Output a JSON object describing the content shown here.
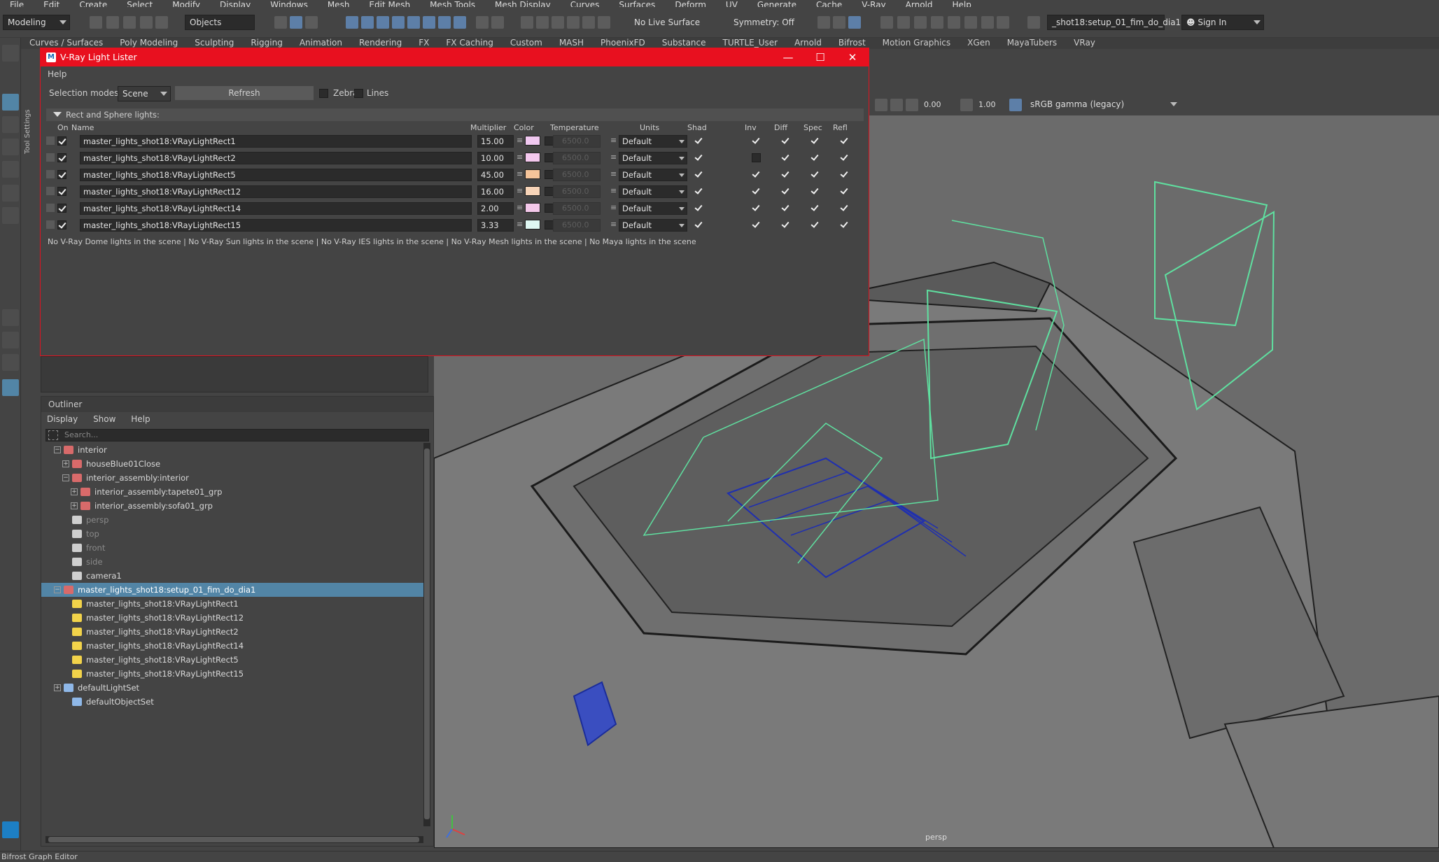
{
  "menubar": [
    "File",
    "Edit",
    "Create",
    "Select",
    "Modify",
    "Display",
    "Windows",
    "Mesh",
    "Edit Mesh",
    "Mesh Tools",
    "Mesh Display",
    "Curves",
    "Surfaces",
    "Deform",
    "UV",
    "Generate",
    "Cache",
    "V-Ray",
    "Arnold",
    "Help"
  ],
  "statusline": {
    "mode": "Modeling",
    "objects": "Objects",
    "live_surface": "No Live Surface",
    "symmetry": "Symmetry: Off",
    "scene_name": "_shot18:setup_01_fim_do_dia1",
    "sign_in": "Sign In"
  },
  "shelf_tabs": [
    "Curves / Surfaces",
    "Poly Modeling",
    "Sculpting",
    "Rigging",
    "Animation",
    "Rendering",
    "FX",
    "FX Caching",
    "Custom",
    "MASH",
    "PhoenixFD",
    "Substance",
    "TURTLE_User",
    "Arnold",
    "Bifrost",
    "Motion Graphics",
    "XGen",
    "MayaTubers",
    "VRay"
  ],
  "toolbox_label": "Tool Settings",
  "viewport": {
    "value_a": "0.00",
    "value_b": "1.00",
    "color_space": "sRGB gamma (legacy)",
    "camera_label": "persp"
  },
  "lister": {
    "title": "V-Ray Light Lister",
    "menu": "Help",
    "selection_label": "Selection modes:",
    "selection_value": "Scene",
    "refresh": "Refresh",
    "zebra": "Zebra",
    "lines": "Lines",
    "section": "Rect and Sphere lights:",
    "columns": {
      "on": "On",
      "name": "Name",
      "multiplier": "Multiplier",
      "color": "Color",
      "temperature": "Temperature",
      "units": "Units",
      "shad": "Shad",
      "inv": "Inv",
      "diff": "Diff",
      "spec": "Spec",
      "refl": "Refl"
    },
    "lights": [
      {
        "name": "master_lights_shot18:VRayLightRect1",
        "multiplier": "15.00",
        "color": "#f0c8f0",
        "temperature": "6500.0",
        "units": "Default",
        "inv": true
      },
      {
        "name": "master_lights_shot18:VRayLightRect2",
        "multiplier": "10.00",
        "color": "#f4c8ee",
        "temperature": "6500.0",
        "units": "Default",
        "inv": false
      },
      {
        "name": "master_lights_shot18:VRayLightRect5",
        "multiplier": "45.00",
        "color": "#f5c49a",
        "temperature": "6500.0",
        "units": "Default",
        "inv": true
      },
      {
        "name": "master_lights_shot18:VRayLightRect12",
        "multiplier": "16.00",
        "color": "#f7d4b8",
        "temperature": "6500.0",
        "units": "Default",
        "inv": true
      },
      {
        "name": "master_lights_shot18:VRayLightRect14",
        "multiplier": "2.00",
        "color": "#f4c8ea",
        "temperature": "6500.0",
        "units": "Default",
        "inv": true
      },
      {
        "name": "master_lights_shot18:VRayLightRect15",
        "multiplier": "3.33",
        "color": "#dff7f2",
        "temperature": "6500.0",
        "units": "Default",
        "inv": true
      }
    ],
    "footer": "No V-Ray Dome lights in the scene | No V-Ray Sun lights in the scene | No V-Ray IES lights in the scene | No V-Ray Mesh lights in the scene | No Maya lights in the scene"
  },
  "outliner": {
    "title": "Outliner",
    "menu": [
      "Display",
      "Show",
      "Help"
    ],
    "search_placeholder": "Search...",
    "items": [
      {
        "label": "interior",
        "type": "group",
        "expander": "−",
        "dim": false,
        "selected": false
      },
      {
        "label": "houseBlue01Close",
        "type": "group",
        "expander": "+",
        "dim": false,
        "selected": false
      },
      {
        "label": "interior_assembly:interior",
        "type": "group",
        "expander": "−",
        "dim": false,
        "selected": false
      },
      {
        "label": "interior_assembly:tapete01_grp",
        "type": "group",
        "expander": "+",
        "dim": false,
        "selected": false
      },
      {
        "label": "interior_assembly:sofa01_grp",
        "type": "group",
        "expander": "+",
        "dim": false,
        "selected": false
      },
      {
        "label": "persp",
        "type": "camera",
        "expander": "",
        "dim": true,
        "selected": false
      },
      {
        "label": "top",
        "type": "camera",
        "expander": "",
        "dim": true,
        "selected": false
      },
      {
        "label": "front",
        "type": "camera",
        "expander": "",
        "dim": true,
        "selected": false
      },
      {
        "label": "side",
        "type": "camera",
        "expander": "",
        "dim": true,
        "selected": false
      },
      {
        "label": "camera1",
        "type": "camera",
        "expander": "",
        "dim": false,
        "selected": false
      },
      {
        "label": "master_lights_shot18:setup_01_fim_do_dia1",
        "type": "group",
        "expander": "−",
        "dim": false,
        "selected": true
      },
      {
        "label": "master_lights_shot18:VRayLightRect1",
        "type": "light",
        "expander": "",
        "dim": false,
        "selected": false
      },
      {
        "label": "master_lights_shot18:VRayLightRect12",
        "type": "light",
        "expander": "",
        "dim": false,
        "selected": false
      },
      {
        "label": "master_lights_shot18:VRayLightRect2",
        "type": "light",
        "expander": "",
        "dim": false,
        "selected": false
      },
      {
        "label": "master_lights_shot18:VRayLightRect14",
        "type": "light",
        "expander": "",
        "dim": false,
        "selected": false
      },
      {
        "label": "master_lights_shot18:VRayLightRect5",
        "type": "light",
        "expander": "",
        "dim": false,
        "selected": false
      },
      {
        "label": "master_lights_shot18:VRayLightRect15",
        "type": "light",
        "expander": "",
        "dim": false,
        "selected": false
      },
      {
        "label": "defaultLightSet",
        "type": "set",
        "expander": "+",
        "dim": false,
        "selected": false
      },
      {
        "label": "defaultObjectSet",
        "type": "set",
        "expander": "",
        "dim": false,
        "selected": false
      }
    ]
  },
  "bottom_bar": "Bifrost Graph Editor",
  "colors": {
    "accent": "#5285a6",
    "titlebar": "#e8101f",
    "light_wire": "#5fe0a0",
    "selected_mesh": "#1a2c9a"
  }
}
